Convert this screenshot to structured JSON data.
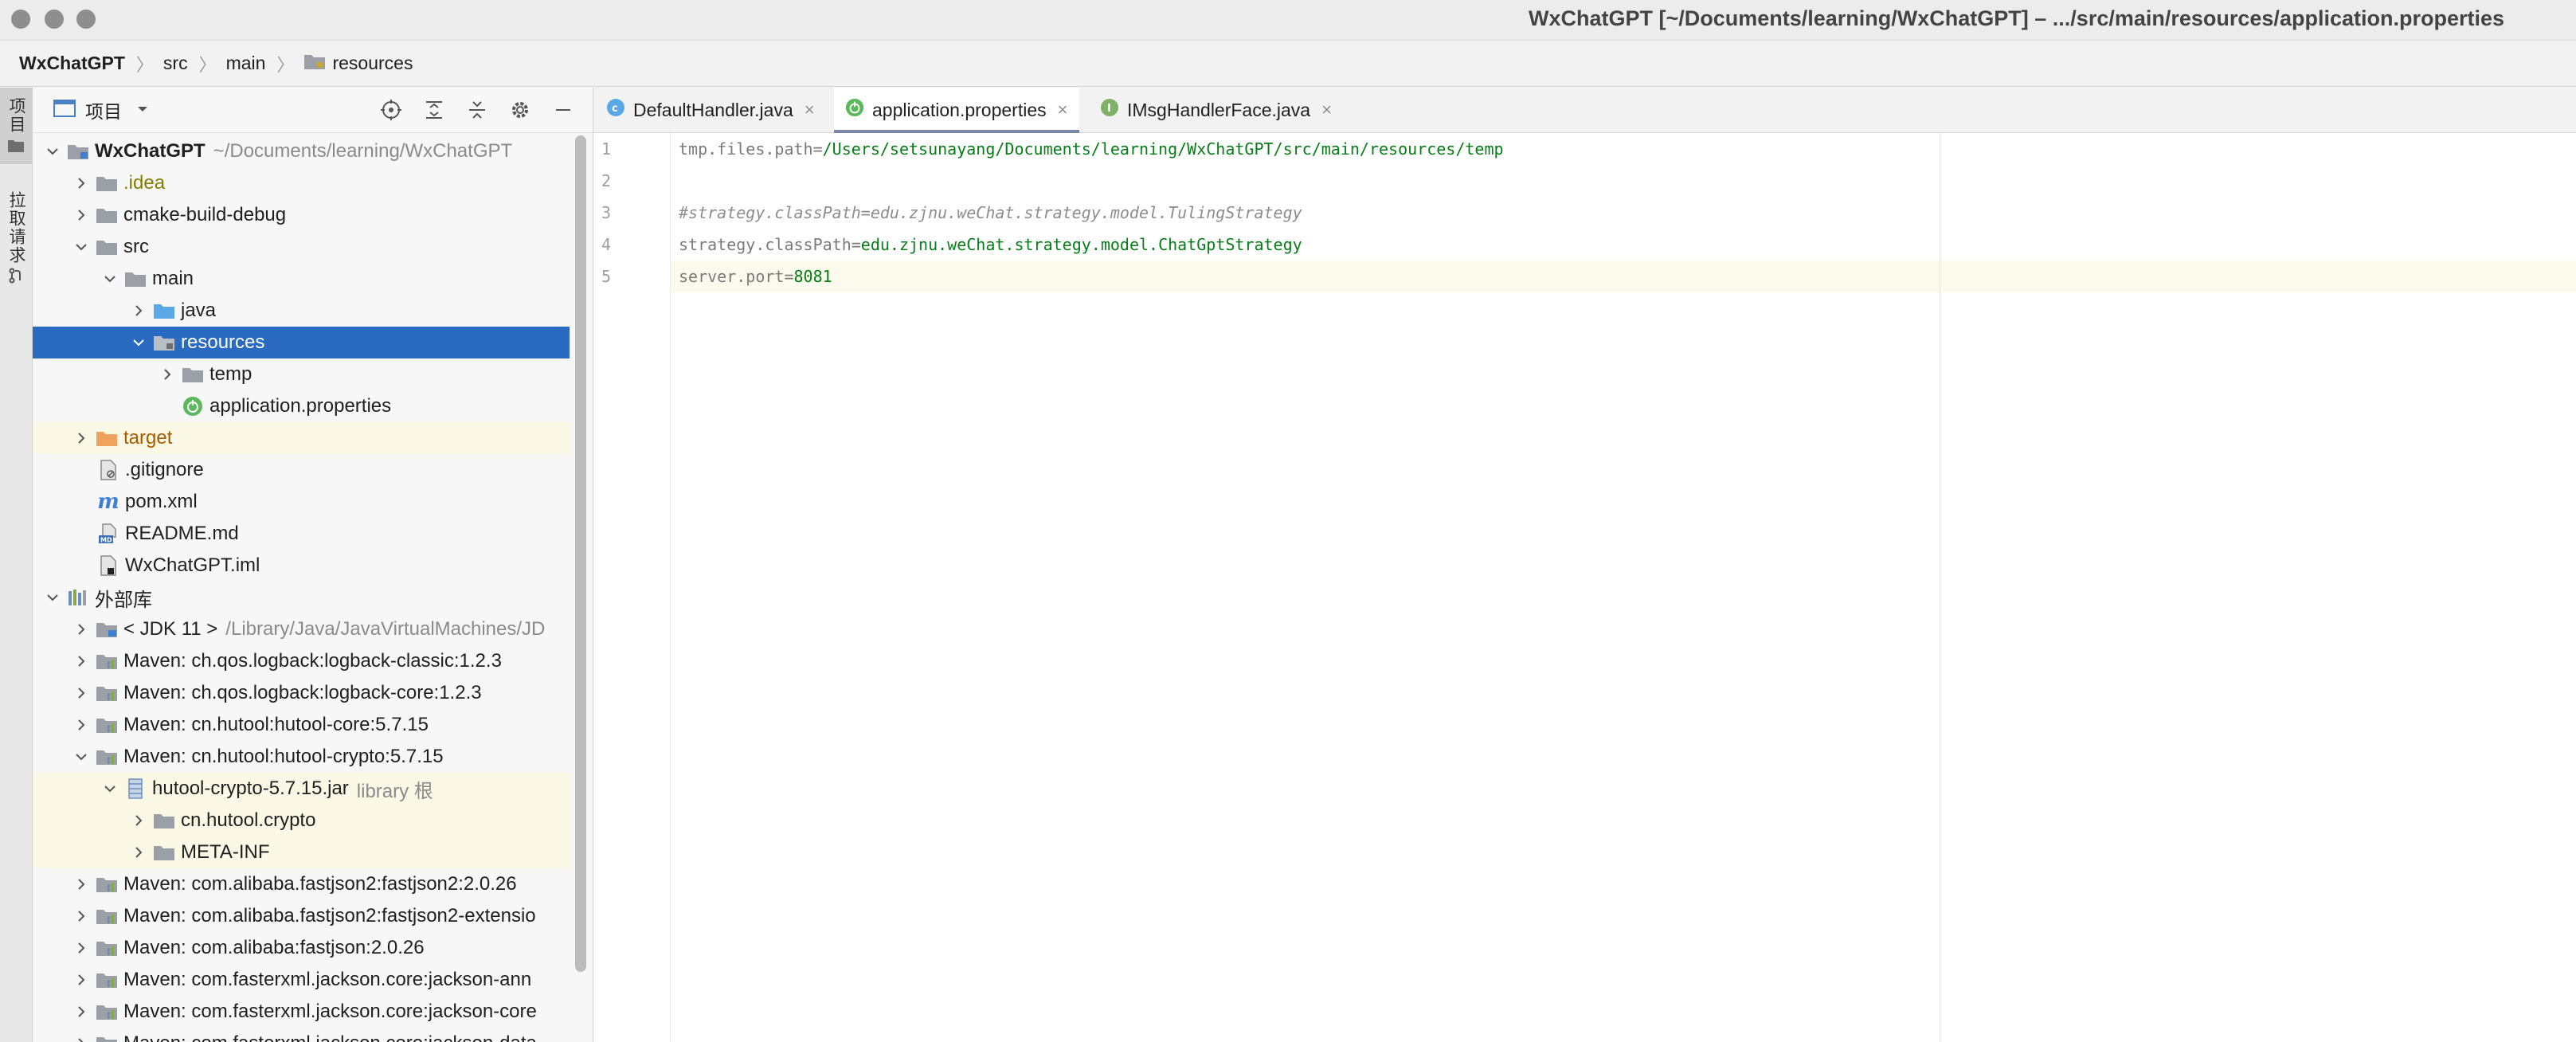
{
  "window": {
    "title": "WxChatGPT [~/Documents/learning/WxChatGPT] – .../src/main/resources/application.properties"
  },
  "breadcrumb": [
    "WxChatGPT",
    "src",
    "main",
    "resources"
  ],
  "toolstrip": {
    "project_label": "项目",
    "pull_requests_label": "拉取请求"
  },
  "project_panel": {
    "title": "项目",
    "tree": [
      {
        "label": "WxChatGPT",
        "hint": "~/Documents/learning/WxChatGPT"
      },
      {
        "label": ".idea"
      },
      {
        "label": "cmake-build-debug"
      },
      {
        "label": "src"
      },
      {
        "label": "main"
      },
      {
        "label": "java"
      },
      {
        "label": "resources"
      },
      {
        "label": "temp"
      },
      {
        "label": "application.properties"
      },
      {
        "label": "target"
      },
      {
        "label": ".gitignore"
      },
      {
        "label": "pom.xml"
      },
      {
        "label": "README.md"
      },
      {
        "label": "WxChatGPT.iml"
      },
      {
        "label": "外部库"
      },
      {
        "label": "< JDK 11 >",
        "hint": "/Library/Java/JavaVirtualMachines/JD"
      },
      {
        "label": "Maven: ch.qos.logback:logback-classic:1.2.3"
      },
      {
        "label": "Maven: ch.qos.logback:logback-core:1.2.3"
      },
      {
        "label": "Maven: cn.hutool:hutool-core:5.7.15"
      },
      {
        "label": "Maven: cn.hutool:hutool-crypto:5.7.15"
      },
      {
        "label": "hutool-crypto-5.7.15.jar",
        "hint": "library 根"
      },
      {
        "label": "cn.hutool.crypto"
      },
      {
        "label": "META-INF"
      },
      {
        "label": "Maven: com.alibaba.fastjson2:fastjson2:2.0.26"
      },
      {
        "label": "Maven: com.alibaba.fastjson2:fastjson2-extensio"
      },
      {
        "label": "Maven: com.alibaba:fastjson:2.0.26"
      },
      {
        "label": "Maven: com.fasterxml.jackson.core:jackson-ann"
      },
      {
        "label": "Maven: com.fasterxml.jackson.core:jackson-core"
      },
      {
        "label": "Maven: com.fasterxml.jackson.core:jackson-data"
      }
    ]
  },
  "editor": {
    "tabs": [
      {
        "label": "DefaultHandler.java",
        "icon": "class-icon"
      },
      {
        "label": "application.properties",
        "icon": "spring-properties-icon"
      },
      {
        "label": "IMsgHandlerFace.java",
        "icon": "interface-icon"
      }
    ],
    "tab_close": "×",
    "lines": [
      {
        "num": "1",
        "key": "tmp.files.path",
        "eq": "=",
        "value": "/Users/setsunayang/Documents/learning/WxChatGPT/src/main/resources/temp"
      },
      {
        "num": "2",
        "key": "",
        "eq": "",
        "value": ""
      },
      {
        "num": "3",
        "comment": "#strategy.classPath=edu.zjnu.weChat.strategy.model.TulingStrategy"
      },
      {
        "num": "4",
        "key": "strategy.classPath",
        "eq": "=",
        "value": "edu.zjnu.weChat.strategy.model.ChatGptStrategy"
      },
      {
        "num": "5",
        "key": "server.port",
        "eq": "=",
        "value": "8081"
      }
    ]
  },
  "colors": {
    "selection": "#2a6bc1",
    "property_value": "#067d17",
    "folder": "#9aa0a6",
    "source_folder": "#5aa9e6",
    "excluded_folder": "#f0a35e"
  }
}
